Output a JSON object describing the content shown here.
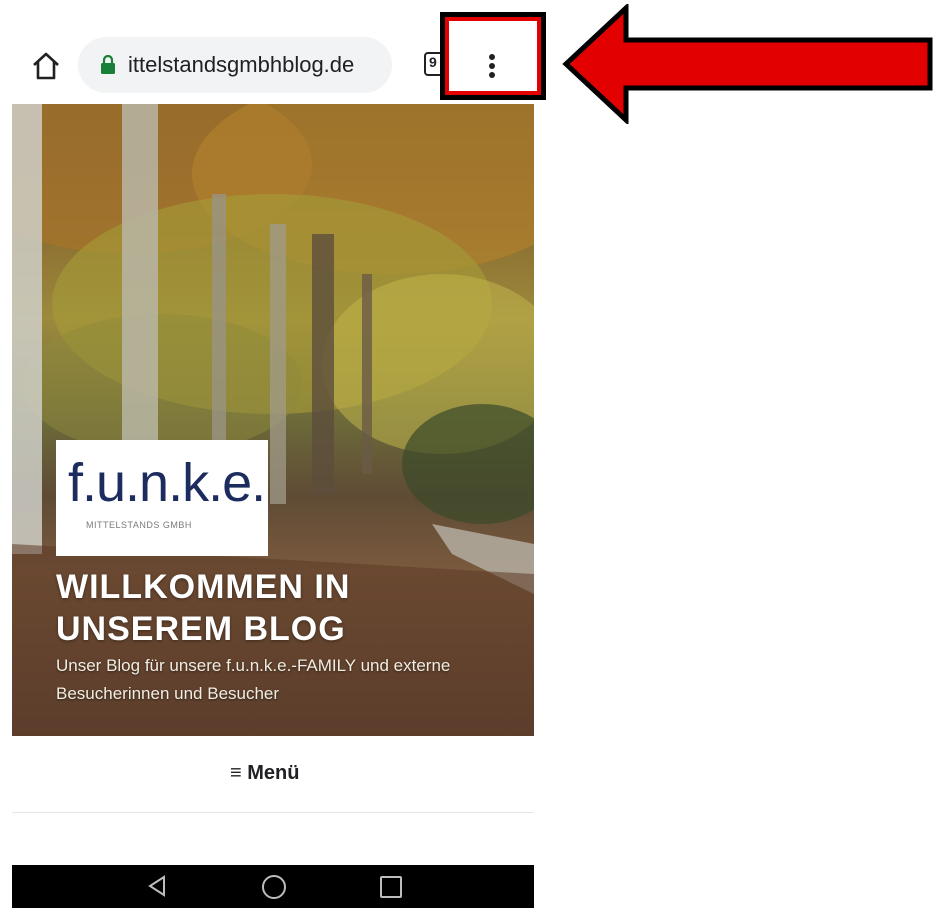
{
  "browser": {
    "url": "ittelstandsgmbhblog.de",
    "tab_count": "9"
  },
  "hero": {
    "logo_text": "f.u.n.k.e.",
    "logo_subtitle": "MITTELSTANDS GMBH",
    "title": "WILLKOMMEN IN UNSEREM BLOG",
    "subtitle": "Unser Blog für unsere f.u.n.k.e.-FAMILY und externe Besucherinnen und Besucher"
  },
  "menu": {
    "label": "≡ Menü"
  },
  "colors": {
    "annotation": "#e30000",
    "logo": "#1c2c5e",
    "lock": "#188038"
  },
  "icons": [
    "home-icon",
    "lock-icon",
    "tabs-icon",
    "more-vert-icon",
    "back-icon",
    "home-circle-icon",
    "recent-apps-icon",
    "arrow-icon"
  ]
}
